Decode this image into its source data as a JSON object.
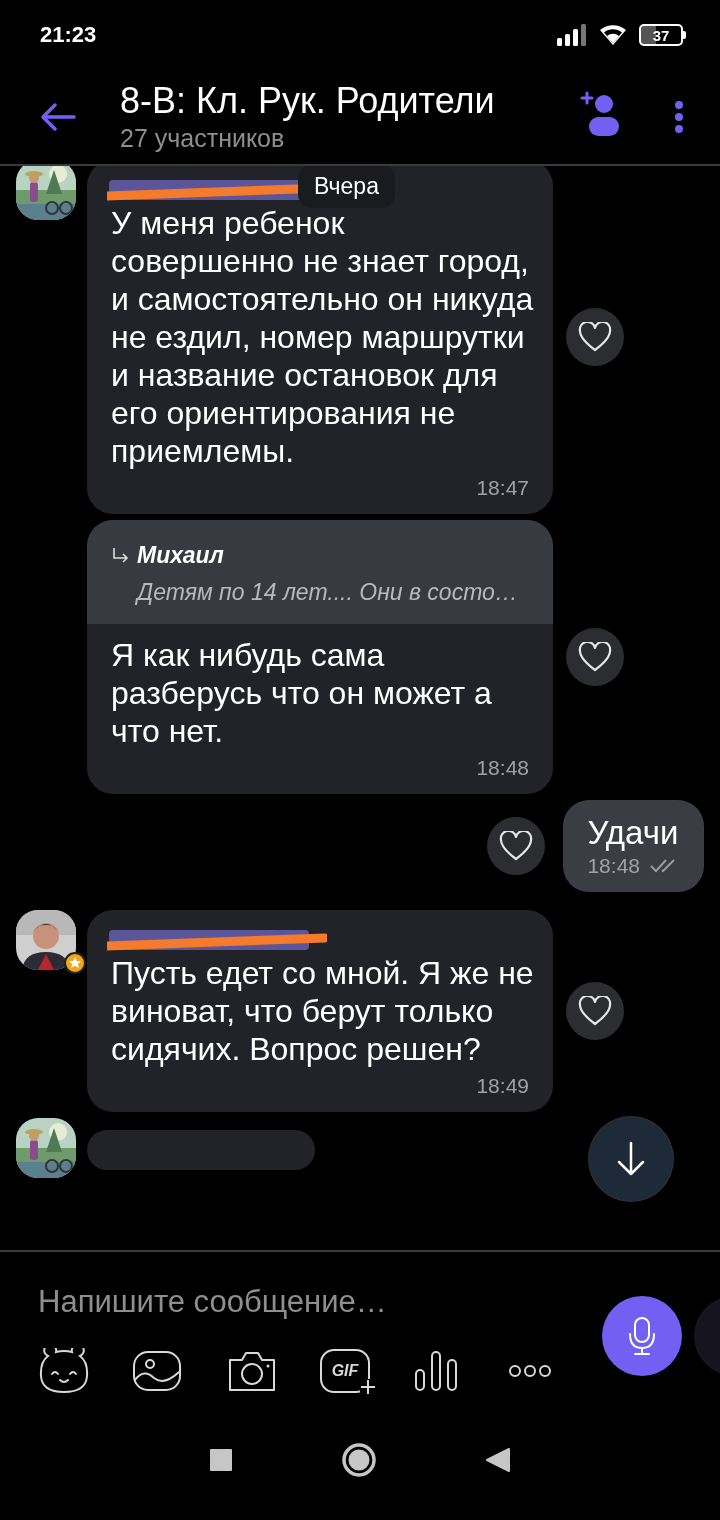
{
  "status_bar": {
    "time": "21:23",
    "battery": "37"
  },
  "header": {
    "title": "8-В: Кл. Рук. Родители",
    "subtitle": "27 участников"
  },
  "date_badge": "Вчера",
  "messages": [
    {
      "kind": "incoming",
      "avatar": true,
      "sender_redacted": true,
      "text": "У меня ребенок совершенно не знает город, и самостоятельно он никуда не ездил, номер маршрутки и название остановок для его ориентирования не приемлемы.",
      "time": "18:47",
      "liked": false
    },
    {
      "kind": "incoming",
      "reply": {
        "author": "Михаил",
        "text": "Детям по 14 лет.... Они в состо…"
      },
      "text": "Я как нибудь сама разберусь что он может а что нет.",
      "time": "18:48",
      "liked": false
    },
    {
      "kind": "outgoing",
      "text": "Удачи",
      "time": "18:48",
      "read": true,
      "liked": false
    },
    {
      "kind": "incoming",
      "avatar": true,
      "badge": true,
      "sender_redacted": true,
      "text": "Пусть едет со мной. Я же не виноват, что берут только сидячих. Вопрос решен?",
      "time": "18:49",
      "liked": false
    },
    {
      "kind": "cut",
      "avatar": true
    }
  ],
  "composer": {
    "placeholder": "Напишите сообщение…"
  },
  "tools": [
    {
      "kind": "sticker"
    },
    {
      "kind": "gallery"
    },
    {
      "kind": "camera"
    },
    {
      "kind": "gif",
      "label": "GIF"
    },
    {
      "kind": "voice"
    },
    {
      "kind": "more"
    }
  ]
}
